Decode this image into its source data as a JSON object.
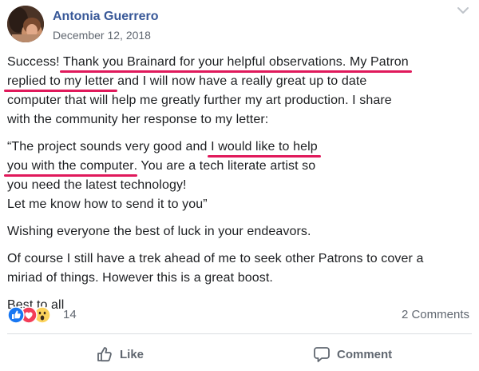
{
  "post": {
    "author": "Antonia Guerrero",
    "date": "December 12, 2018",
    "paragraphs": {
      "p1": {
        "l1a": "Success! ",
        "l1b": "Thank you Brainard for your helpful observations. My Patron",
        "l2a": "replied to my letter",
        "l2b": " and I will now have a really great up to date",
        "l3": "computer that will help me greatly further my art production. I share",
        "l4": "with the community her response to my letter:"
      },
      "p2": {
        "l1a": "“The project sounds very good and ",
        "l1b": "I would like to help",
        "l2a": "you with the computer",
        "l2b": ". You are a tech literate artist so",
        "l3": "you need the latest technology!",
        "l4": "Let me know how to send it to you”"
      },
      "p3": "Wishing everyone the best of luck in your endeavors.",
      "p4": {
        "l1": "Of course I still have a trek ahead of me to seek other Patrons to cover a",
        "l2": "miriad of things. However this is a great boost."
      },
      "p5": "Best to all"
    },
    "reactions": {
      "icons": [
        "like-icon",
        "love-icon",
        "wow-icon"
      ],
      "count": "14",
      "comments": "2 Comments"
    },
    "actions": {
      "like": "Like",
      "comment": "Comment"
    }
  },
  "colors": {
    "author": "#385898",
    "underline": "#e0195b",
    "like_blue": "#1877f2",
    "love_red": "#f33e58",
    "wow_yellow": "#fcd35c",
    "muted": "#606770"
  }
}
